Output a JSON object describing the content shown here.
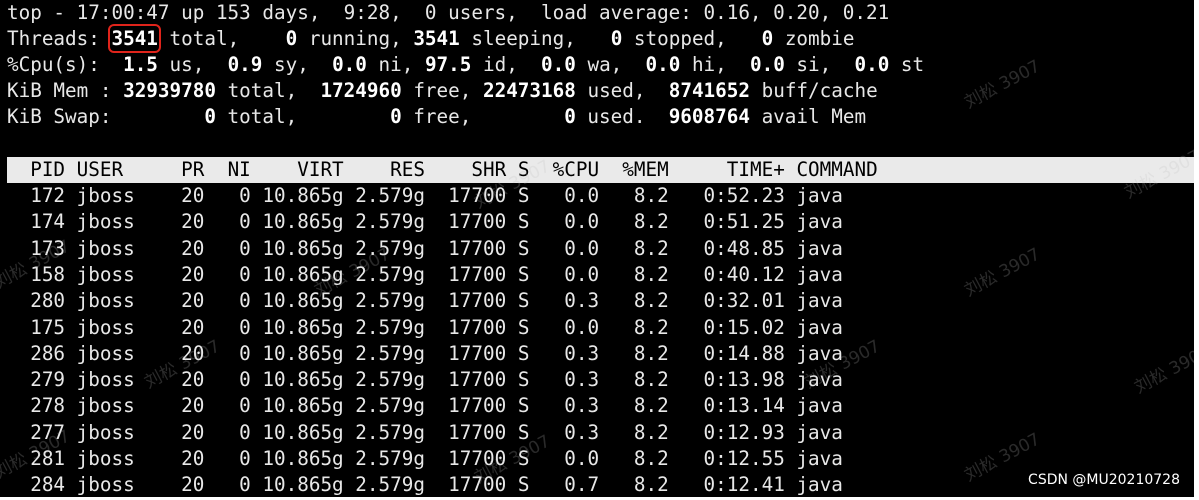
{
  "summary": {
    "line1": "top - 17:00:47 up 153 days,  9:28,  0 users,  load average: 0.16, 0.20, 0.21",
    "threads": {
      "prefix": "Threads: ",
      "total": "3541",
      "total_label": " total,    ",
      "running": "0",
      "running_label": " running, ",
      "sleeping": "3541",
      "sleeping_label": " sleeping,   ",
      "stopped": "0",
      "stopped_label": " stopped,   ",
      "zombie": "0",
      "zombie_label": " zombie"
    },
    "cpu": {
      "prefix": "%Cpu(s):  ",
      "us": "1.5",
      "us_label": " us,  ",
      "sy": "0.9",
      "sy_label": " sy,  ",
      "ni": "0.0",
      "ni_label": " ni, ",
      "id": "97.5",
      "id_label": " id,  ",
      "wa": "0.0",
      "wa_label": " wa,  ",
      "hi": "0.0",
      "hi_label": " hi,  ",
      "si": "0.0",
      "si_label": " si,  ",
      "st": "0.0",
      "st_label": " st"
    },
    "mem": {
      "prefix": "KiB Mem : ",
      "total": "32939780",
      "total_label": " total,  ",
      "free": "1724960",
      "free_label": " free, ",
      "used": "22473168",
      "used_label": " used,  ",
      "buff": "8741652",
      "buff_label": " buff/cache"
    },
    "swap": {
      "prefix": "KiB Swap:        ",
      "total": "0",
      "total_label": " total,        ",
      "free": "0",
      "free_label": " free,        ",
      "used": "0",
      "used_label": " used.  ",
      "avail": "9608764",
      "avail_label": " avail Mem"
    }
  },
  "columns": [
    "PID",
    "USER",
    "PR",
    "NI",
    "VIRT",
    "RES",
    "SHR",
    "S",
    "%CPU",
    "%MEM",
    "TIME+",
    "COMMAND"
  ],
  "rows": [
    [
      "172",
      "jboss",
      "20",
      "0",
      "10.865g",
      "2.579g",
      "17700",
      "S",
      "0.0",
      "8.2",
      "0:52.23",
      "java"
    ],
    [
      "174",
      "jboss",
      "20",
      "0",
      "10.865g",
      "2.579g",
      "17700",
      "S",
      "0.0",
      "8.2",
      "0:51.25",
      "java"
    ],
    [
      "173",
      "jboss",
      "20",
      "0",
      "10.865g",
      "2.579g",
      "17700",
      "S",
      "0.0",
      "8.2",
      "0:48.85",
      "java"
    ],
    [
      "158",
      "jboss",
      "20",
      "0",
      "10.865g",
      "2.579g",
      "17700",
      "S",
      "0.0",
      "8.2",
      "0:40.12",
      "java"
    ],
    [
      "280",
      "jboss",
      "20",
      "0",
      "10.865g",
      "2.579g",
      "17700",
      "S",
      "0.3",
      "8.2",
      "0:32.01",
      "java"
    ],
    [
      "175",
      "jboss",
      "20",
      "0",
      "10.865g",
      "2.579g",
      "17700",
      "S",
      "0.0",
      "8.2",
      "0:15.02",
      "java"
    ],
    [
      "286",
      "jboss",
      "20",
      "0",
      "10.865g",
      "2.579g",
      "17700",
      "S",
      "0.3",
      "8.2",
      "0:14.88",
      "java"
    ],
    [
      "279",
      "jboss",
      "20",
      "0",
      "10.865g",
      "2.579g",
      "17700",
      "S",
      "0.3",
      "8.2",
      "0:13.98",
      "java"
    ],
    [
      "278",
      "jboss",
      "20",
      "0",
      "10.865g",
      "2.579g",
      "17700",
      "S",
      "0.3",
      "8.2",
      "0:13.14",
      "java"
    ],
    [
      "277",
      "jboss",
      "20",
      "0",
      "10.865g",
      "2.579g",
      "17700",
      "S",
      "0.3",
      "8.2",
      "0:12.93",
      "java"
    ],
    [
      "281",
      "jboss",
      "20",
      "0",
      "10.865g",
      "2.579g",
      "17700",
      "S",
      "0.0",
      "8.2",
      "0:12.55",
      "java"
    ],
    [
      "284",
      "jboss",
      "20",
      "0",
      "10.865g",
      "2.579g",
      "17700",
      "S",
      "0.7",
      "8.2",
      "0:12.41",
      "java"
    ]
  ],
  "watermark_text": "刘松 3907",
  "credit": "CSDN @MU20210728",
  "colors": {
    "background": "#000000",
    "foreground": "#e8e8e8",
    "header_bar": "#eaeaea",
    "highlight_box": "#e0241b"
  }
}
